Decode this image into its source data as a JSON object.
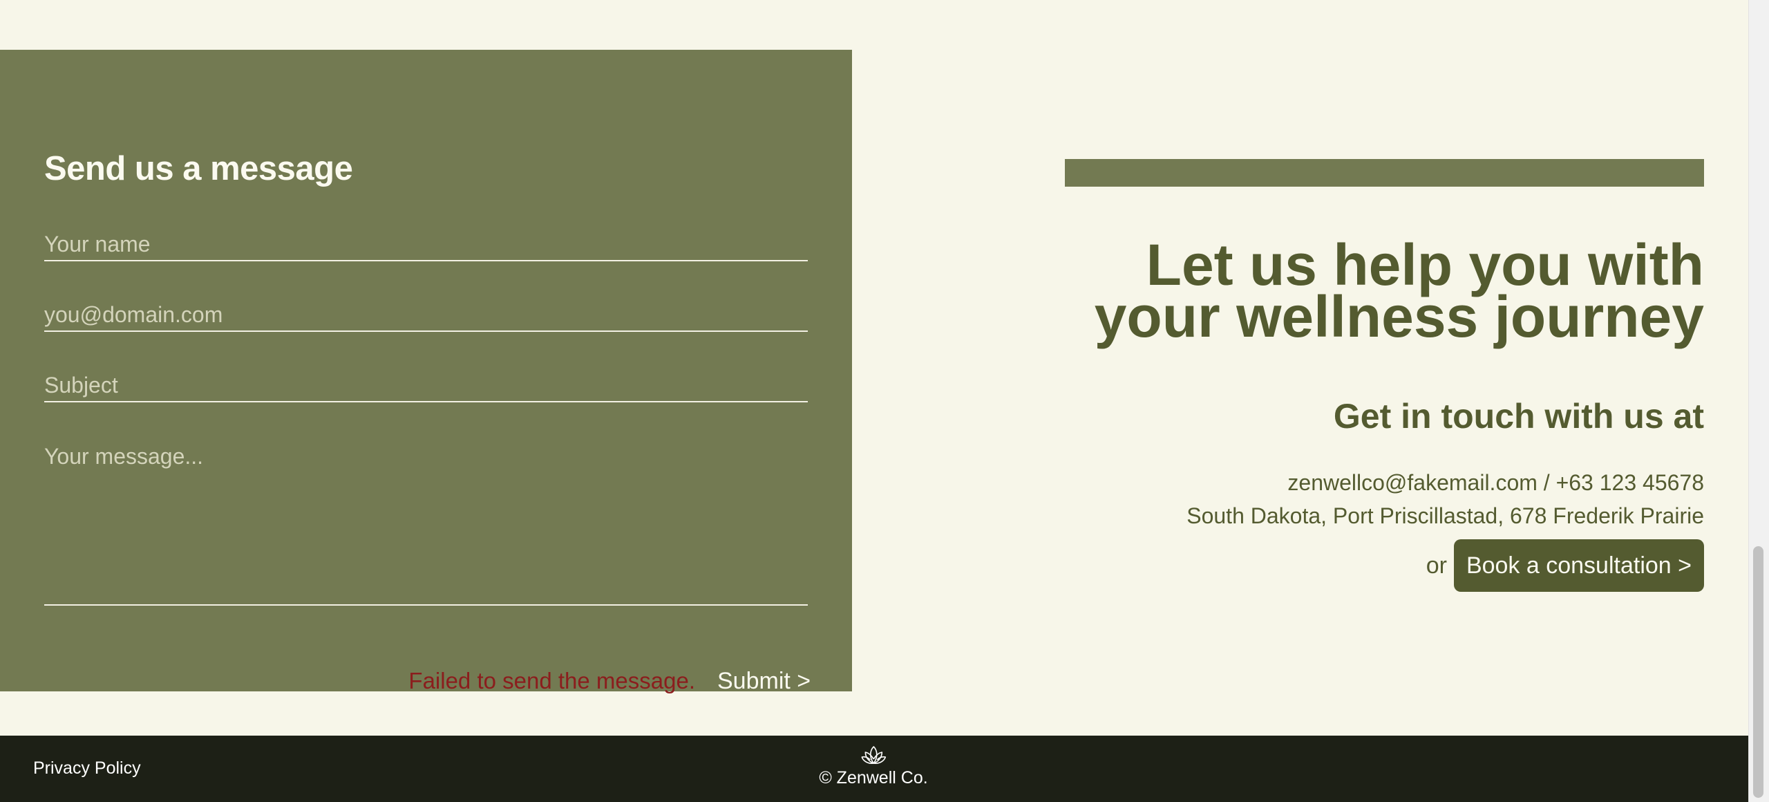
{
  "form": {
    "title": "Send us a message",
    "name_placeholder": "Your name",
    "email_placeholder": "you@domain.com",
    "subject_placeholder": "Subject",
    "message_placeholder": "Your message...",
    "error_text": "Failed to send the message.",
    "submit_label": "Submit >"
  },
  "hero": {
    "heading_line1": "Let us help you with",
    "heading_line2": "your wellness journey",
    "contact_heading": "Get in touch with us at",
    "contact_line1": "zenwellco@fakemail.com / +63 123 45678",
    "contact_line2": "South Dakota, Port Priscillastad, 678 Frederik Prairie",
    "or_text": "or",
    "consult_label": "Book a consultation >"
  },
  "footer": {
    "privacy_label": "Privacy Policy",
    "copyright": "© Zenwell Co.",
    "logo_icon": "lotus-icon"
  },
  "colors": {
    "background": "#f7f6e9",
    "panel": "#737a52",
    "accent_dark": "#545b30",
    "error": "#8b1d1d",
    "footer": "#1d2016"
  }
}
